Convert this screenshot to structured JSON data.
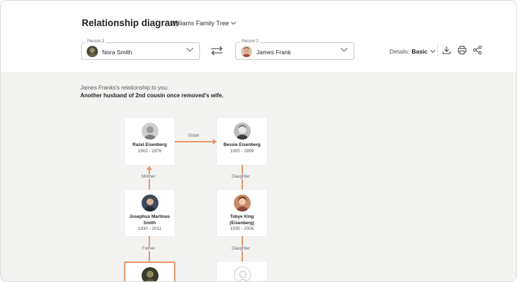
{
  "header": {
    "title": "Relationship diagram",
    "separator": "·",
    "tree_name": "Williams Family Tree"
  },
  "person1": {
    "label": "Person 1",
    "name": "Nora Smith"
  },
  "person2": {
    "label": "Person 2",
    "name": "James Frank"
  },
  "details": {
    "label": "Details:",
    "value": "Basic"
  },
  "relationship": {
    "intro": "James Franks's relationship to you:",
    "text": "Another husband of 2nd cousin once removed's wife."
  },
  "tree": {
    "razel": {
      "name": "Razel Eisenberg",
      "dates": "1902 - 1976"
    },
    "bessie": {
      "name": "Bessie Eisenberg",
      "dates": "1905 - 1999"
    },
    "josephus": {
      "name": "Josephus Martinus Smith",
      "dates": "1930 - 2011"
    },
    "tobye": {
      "name": "Tobye King (Eisenberg)",
      "dates": "1935 - 2006"
    }
  },
  "relations": {
    "sister": "Sister",
    "mother": "Mother",
    "daughter1": "Daughter",
    "father": "Father",
    "daughter2": "Daughter"
  },
  "colors": {
    "accent": "#e8956b",
    "canvas_bg": "#f3f3f1"
  },
  "icons": [
    "chevron-down-icon",
    "swap-arrows-icon",
    "download-icon",
    "print-icon",
    "share-icon",
    "person-placeholder-icon"
  ]
}
